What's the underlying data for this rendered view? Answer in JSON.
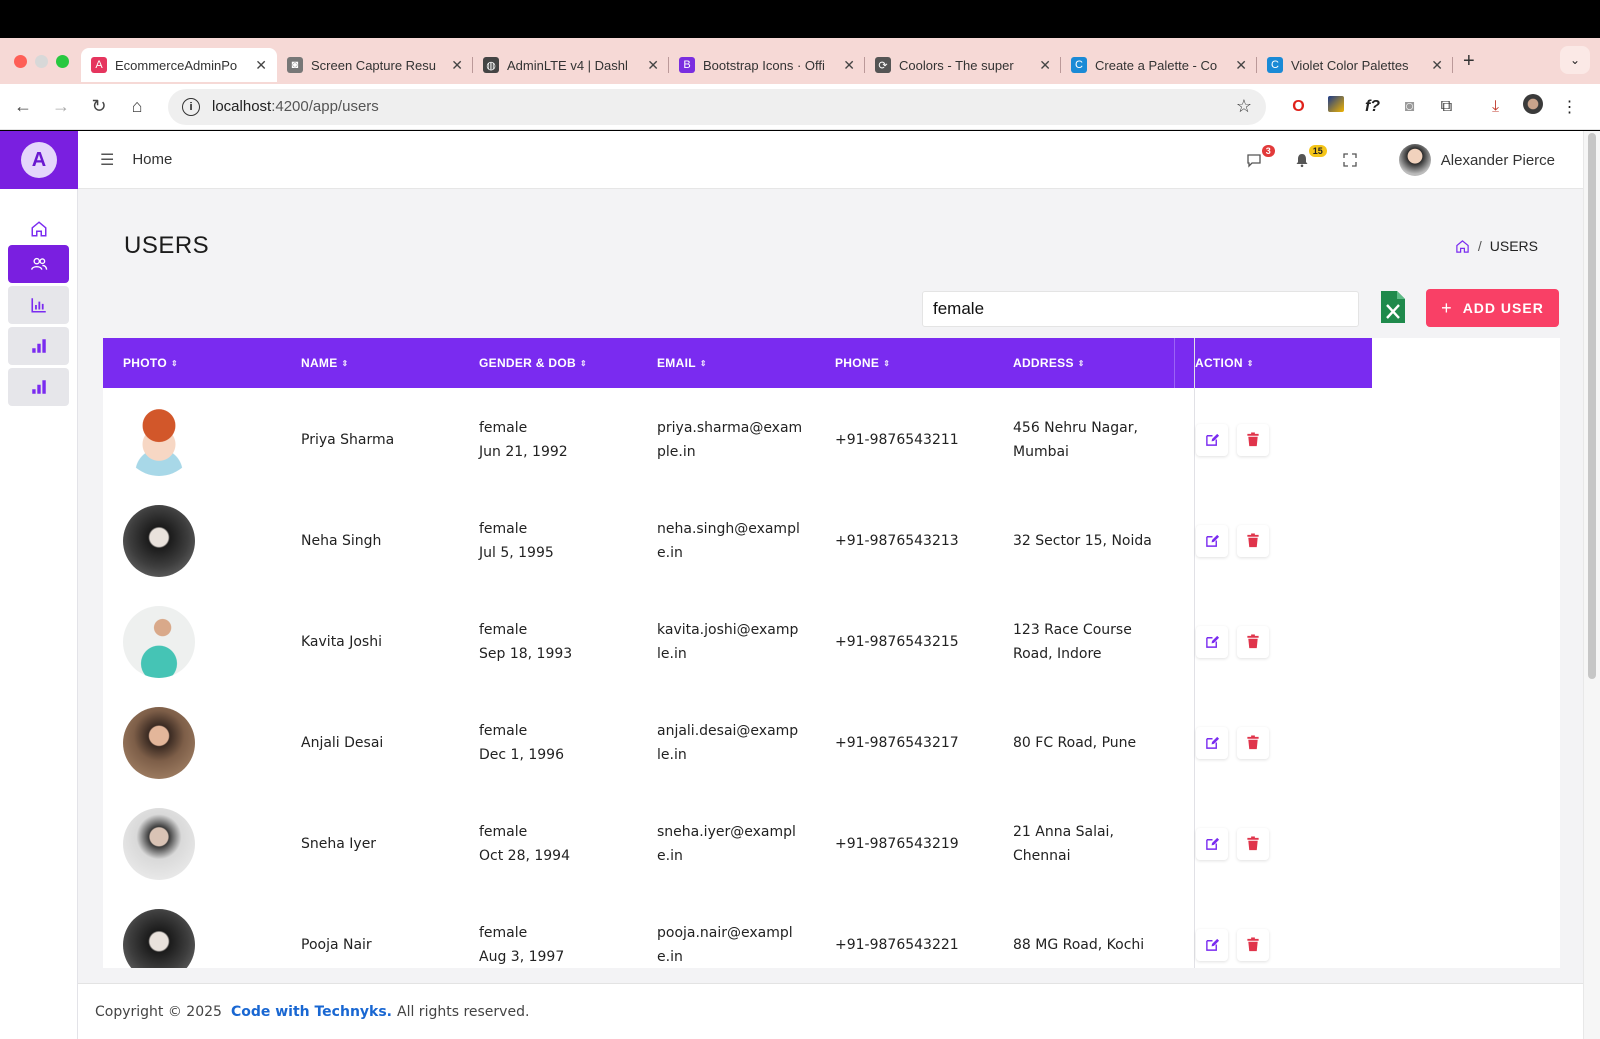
{
  "browser": {
    "tabs": [
      {
        "title": "EcommerceAdminPo",
        "active": true,
        "favicon_color": "#e5355e",
        "favicon_glyph": "A"
      },
      {
        "title": "Screen Capture Resu",
        "active": false,
        "favicon_color": "#777777",
        "favicon_glyph": "◙"
      },
      {
        "title": "AdminLTE v4 | Dashl",
        "active": false,
        "favicon_color": "#444444",
        "favicon_glyph": "◍"
      },
      {
        "title": "Bootstrap Icons · Offi",
        "active": false,
        "favicon_color": "#7a2ee0",
        "favicon_glyph": "B"
      },
      {
        "title": "Coolors - The super",
        "active": false,
        "favicon_color": "#555555",
        "favicon_glyph": "⟳"
      },
      {
        "title": "Create a Palette - Co",
        "active": false,
        "favicon_color": "#1a8ad6",
        "favicon_glyph": "C"
      },
      {
        "title": "Violet Color Palettes",
        "active": false,
        "favicon_color": "#1a8ad6",
        "favicon_glyph": "C"
      }
    ],
    "url_host": "localhost",
    "url_path": ":4200/app/users"
  },
  "header": {
    "home_label": "Home",
    "messages_count": "3",
    "notifications_count": "15",
    "user_name": "Alexander Pierce"
  },
  "page": {
    "title": "USERS",
    "breadcrumb_current": "USERS",
    "search_value": "female",
    "add_button_label": "ADD USER"
  },
  "table": {
    "columns": [
      "PHOTO",
      "NAME",
      "GENDER & DOB",
      "EMAIL",
      "PHONE",
      "ADDRESS",
      "ACTION"
    ],
    "rows": [
      {
        "name": "Priya Sharma",
        "gender": "female",
        "dob": "Jun 21, 1992",
        "email_1": "priya.sharma@exam",
        "email_2": "ple.in",
        "phone": "+91-9876543211",
        "address_1": "456 Nehru Nagar,",
        "address_2": "Mumbai",
        "avatar": "cartoon"
      },
      {
        "name": "Neha Singh",
        "gender": "female",
        "dob": "Jul 5, 1995",
        "email_1": "neha.singh@exampl",
        "email_2": "e.in",
        "phone": "+91-9876543213",
        "address_1": "32 Sector 15, Noida",
        "address_2": "",
        "avatar": "dark"
      },
      {
        "name": "Kavita Joshi",
        "gender": "female",
        "dob": "Sep 18, 1993",
        "email_1": "kavita.joshi@examp",
        "email_2": "le.in",
        "phone": "+91-9876543215",
        "address_1": "123 Race Course",
        "address_2": "Road, Indore",
        "avatar": "teal"
      },
      {
        "name": "Anjali Desai",
        "gender": "female",
        "dob": "Dec 1, 1996",
        "email_1": "anjali.desai@examp",
        "email_2": "le.in",
        "phone": "+91-9876543217",
        "address_1": "80 FC Road, Pune",
        "address_2": "",
        "avatar": "brown"
      },
      {
        "name": "Sneha Iyer",
        "gender": "female",
        "dob": "Oct 28, 1994",
        "email_1": "sneha.iyer@exampl",
        "email_2": "e.in",
        "phone": "+91-9876543219",
        "address_1": "21 Anna Salai,",
        "address_2": "Chennai",
        "avatar": "light"
      },
      {
        "name": "Pooja Nair",
        "gender": "female",
        "dob": "Aug 3, 1997",
        "email_1": "pooja.nair@exampl",
        "email_2": "e.in",
        "phone": "+91-9876543221",
        "address_1": "88 MG Road, Kochi",
        "address_2": "",
        "avatar": "dark"
      }
    ]
  },
  "footer": {
    "prefix": "Copyright © 2025",
    "brand": "Code with Technyks.",
    "suffix": "All rights reserved."
  },
  "colors": {
    "accent": "#7a2bf0",
    "add_button": "#f94066",
    "delete": "#e0344b",
    "link": "#1967d2"
  },
  "icons": {
    "sidebar": [
      "home-icon",
      "users-icon",
      "bar-chart-icon",
      "bar-chart-steps-icon",
      "bar-chart-steps-icon"
    ]
  }
}
